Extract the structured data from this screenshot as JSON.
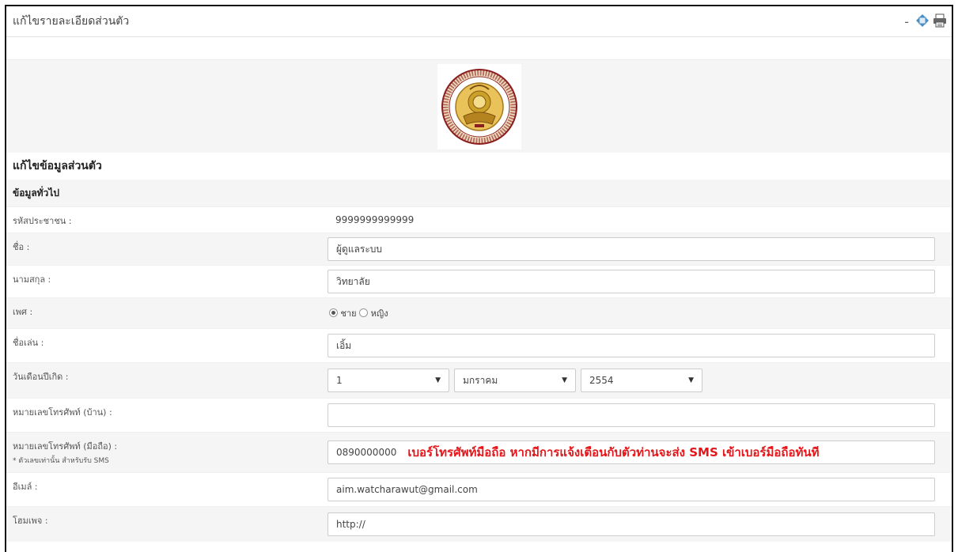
{
  "window": {
    "title": "แก้ไขรายละเอียดส่วนตัว",
    "minimize_label": "-"
  },
  "form": {
    "heading": "แก้ไขข้อมูลส่วนตัว",
    "section": "ข้อมูลทั่วไป",
    "citizen_id": {
      "label": "รหัสประชาชน :",
      "value": "9999999999999"
    },
    "first_name": {
      "label": "ชื่อ :",
      "value": "ผู้ดูแลระบบ"
    },
    "last_name": {
      "label": "นามสกุล :",
      "value": "วิทยาลัย"
    },
    "gender": {
      "label": "เพศ :",
      "options": [
        "ชาย",
        "หญิง"
      ],
      "selected": "ชาย"
    },
    "nickname": {
      "label": "ชื่อเล่น :",
      "value": "เอิ้ม"
    },
    "birthdate": {
      "label": "วันเดือนปีเกิด :",
      "day": "1",
      "month": "มกราคม",
      "year": "2554"
    },
    "home_phone": {
      "label": "หมายเลขโทรศัพท์ (บ้าน) :",
      "value": ""
    },
    "mobile_phone": {
      "label": "หมายเลขโทรศัพท์ (มือถือ) :",
      "note": "* ตัวเลขเท่านั้น สำหรับรับ SMS",
      "value": "0890000000",
      "sms_notice": "เบอร์โทรศัพท์มือถือ หากมีการแจ้งเตือนกับตัวท่านจะส่ง SMS เข้าเบอร์มือถือทันที"
    },
    "email": {
      "label": "อีเมล์ :",
      "value": "aim.watcharawut@gmail.com"
    },
    "homepage": {
      "label": "โฮมเพจ :",
      "value": "http://"
    }
  },
  "colors": {
    "notice_red": "#e3171b",
    "row_alt": "#f5f5f5",
    "logo_gold": "#c9a227",
    "logo_maroon": "#8b1e1e"
  },
  "icons": [
    "move-icon",
    "print-icon",
    "vec-emblem-logo"
  ]
}
